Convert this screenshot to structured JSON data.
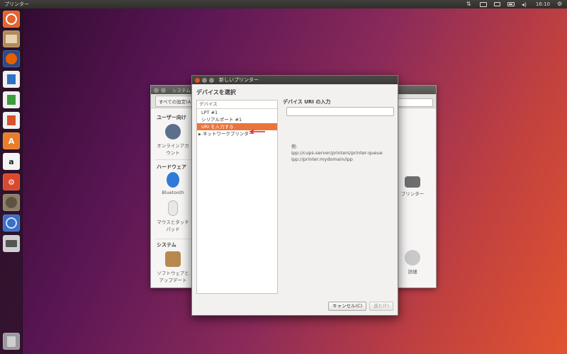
{
  "topbar": {
    "app_title": "プリンター",
    "clock": "16:10",
    "indicators": [
      "updown-icon",
      "keyboard-icon",
      "mail-icon",
      "battery-icon",
      "volume-icon",
      "gear-icon"
    ]
  },
  "launcher": {
    "items": [
      {
        "name": "ubuntu-dash-icon",
        "color": "#e1642d"
      },
      {
        "name": "files-icon",
        "color": "#b48a5b"
      },
      {
        "name": "firefox-icon",
        "color": "#e66000"
      },
      {
        "name": "writer-icon",
        "color": "#2e72c1"
      },
      {
        "name": "calc-icon",
        "color": "#3c9b3c"
      },
      {
        "name": "impress-icon",
        "color": "#d8512b"
      },
      {
        "name": "software-center-icon",
        "color": "#e87d2c"
      },
      {
        "name": "amazon-icon",
        "color": "#f4f4f4"
      },
      {
        "name": "system-settings-icon",
        "color": "#d9492e"
      },
      {
        "name": "gimp-icon",
        "color": "#8a7f66"
      },
      {
        "name": "shotwell-icon",
        "color": "#3a6fc4"
      },
      {
        "name": "printer-icon",
        "color": "#cfcfcf"
      },
      {
        "name": "trash-icon",
        "color": "#9a9a9a"
      }
    ]
  },
  "settings_window": {
    "title": "システム...",
    "all_settings": "すべての設定(A)",
    "sections": {
      "personal": "ユーザー向け",
      "hardware": "ハードウェア",
      "system": "システム"
    },
    "items": {
      "online_accounts": "オンラインアカウント",
      "bluetooth": "Bluetooth",
      "mouse": "マウスとタッチパッド",
      "software_updates": "ソフトウェアとアップデート",
      "printers": "プリンター",
      "details": "詳細"
    }
  },
  "dialog": {
    "title": "新しいプリンター",
    "heading": "デバイスを選択",
    "device_list_header": "デバイス",
    "devices": [
      {
        "label": "LPT #1",
        "selected": false,
        "expandable": false
      },
      {
        "label": "シリアルポート #1",
        "selected": false,
        "expandable": false
      },
      {
        "label": "URI を入力する",
        "selected": true,
        "expandable": false
      },
      {
        "label": "ネットワークプリンター",
        "selected": false,
        "expandable": true
      }
    ],
    "uri_label": "デバイス URI の入力",
    "uri_value": "",
    "example_title": "例:",
    "example_lines": [
      "ipp://cups-server/printers/printer-queue",
      "ipp://printer.mydomain/ipp"
    ],
    "cancel_label": "キャンセル(C)",
    "forward_label": "進む(F)",
    "accent_color": "#e9753d"
  }
}
